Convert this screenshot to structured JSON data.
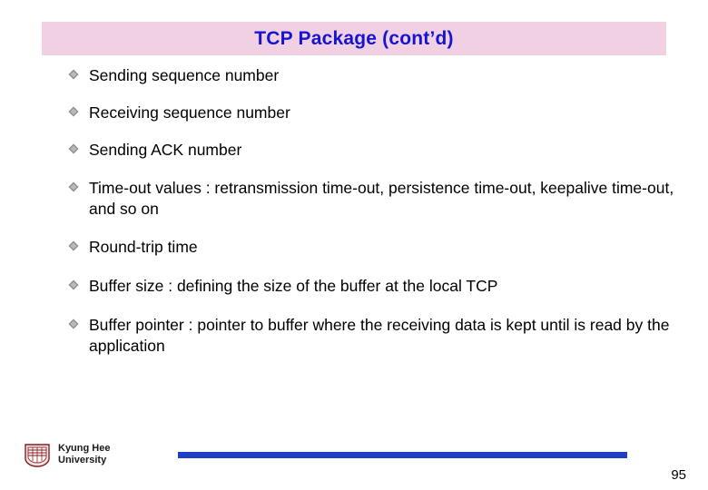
{
  "slide": {
    "title": "TCP Package (cont’d)",
    "title_bg": "#f2d0e4",
    "title_color": "#1515cf",
    "bullets": [
      {
        "text": "Sending sequence number"
      },
      {
        "text": "Receiving sequence number"
      },
      {
        "text": "Sending ACK number"
      },
      {
        "text": "Time-out values : retransmission time-out, persistence time-out, keepalive time-out, and so on"
      },
      {
        "text": "Round-trip time"
      },
      {
        "text": "Buffer size : defining the size of the buffer at the local TCP"
      },
      {
        "text": "Buffer pointer : pointer to buffer where the receiving data is kept until is read by the application"
      }
    ],
    "footer": {
      "org_line1": "Kyung Hee",
      "org_line2": "University",
      "rule_color": "#1f3fc4",
      "page_number": "95"
    }
  }
}
